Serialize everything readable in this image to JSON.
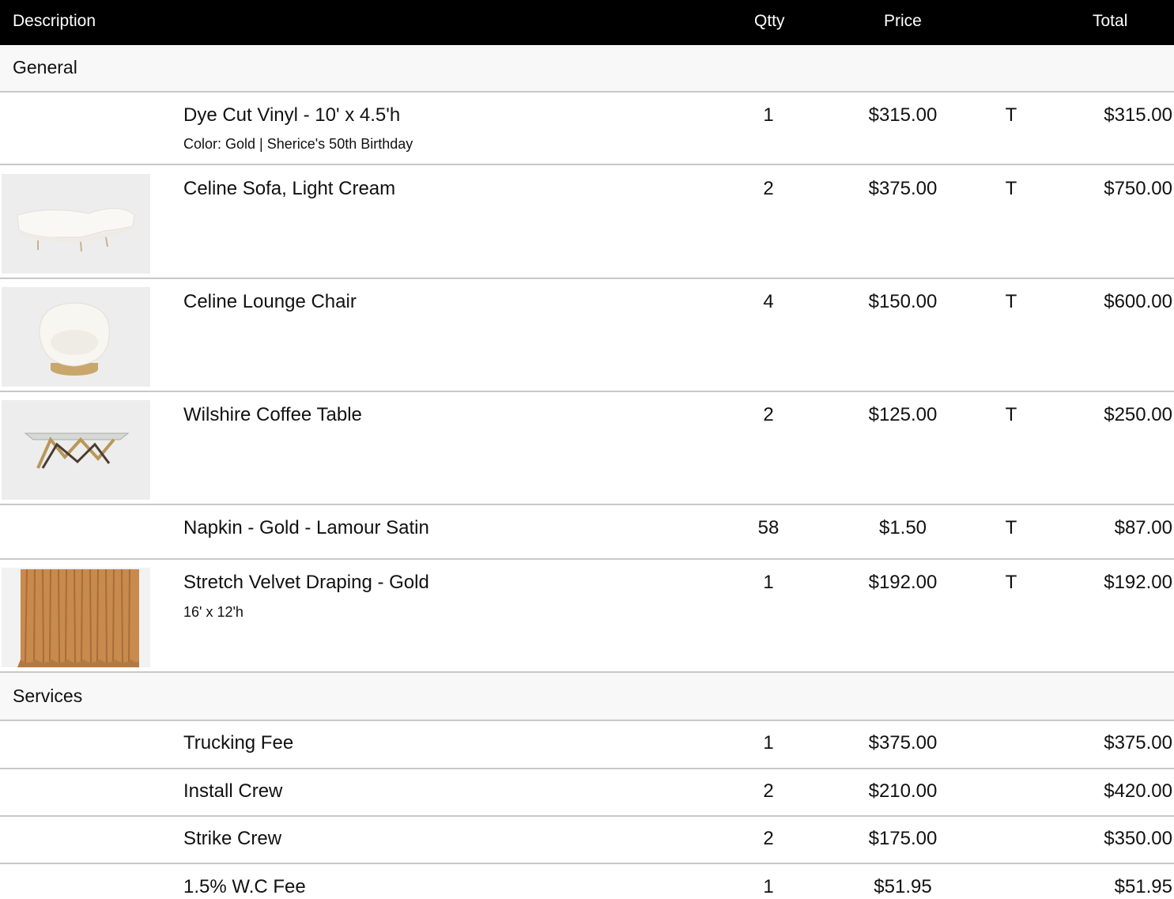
{
  "header": {
    "description": "Description",
    "qty": "Qtty",
    "price": "Price",
    "total": "Total"
  },
  "sections": [
    {
      "title": "General",
      "items": [
        {
          "name": "Dye Cut Vinyl - 10' x 4.5'h",
          "sub": "Color: Gold | Sherice's 50th Birthday",
          "qty": "1",
          "price": "$315.00",
          "tax": "T",
          "total": "$315.00",
          "image": ""
        },
        {
          "name": "Celine Sofa, Light Cream",
          "sub": "",
          "qty": "2",
          "price": "$375.00",
          "tax": "T",
          "total": "$750.00",
          "image": "sofa"
        },
        {
          "name": "Celine Lounge Chair",
          "sub": "",
          "qty": "4",
          "price": "$150.00",
          "tax": "T",
          "total": "$600.00",
          "image": "lounge-chair"
        },
        {
          "name": "Wilshire Coffee Table",
          "sub": "",
          "qty": "2",
          "price": "$125.00",
          "tax": "T",
          "total": "$250.00",
          "image": "coffee-table"
        },
        {
          "name": "Napkin - Gold - Lamour Satin",
          "sub": "",
          "qty": "58",
          "price": "$1.50",
          "tax": "T",
          "total": "$87.00",
          "image": ""
        },
        {
          "name": "Stretch Velvet Draping - Gold",
          "sub": "16' x 12'h",
          "qty": "1",
          "price": "$192.00",
          "tax": "T",
          "total": "$192.00",
          "image": "draping"
        }
      ]
    },
    {
      "title": "Services",
      "items": [
        {
          "name": "Trucking Fee",
          "sub": "",
          "qty": "1",
          "price": "$375.00",
          "tax": "",
          "total": "$375.00",
          "image": ""
        },
        {
          "name": "Install Crew",
          "sub": "",
          "qty": "2",
          "price": "$210.00",
          "tax": "",
          "total": "$420.00",
          "image": ""
        },
        {
          "name": "Strike Crew",
          "sub": "",
          "qty": "2",
          "price": "$175.00",
          "tax": "",
          "total": "$350.00",
          "image": ""
        },
        {
          "name": "1.5% W.C Fee",
          "sub": "",
          "qty": "1",
          "price": "$51.95",
          "tax": "",
          "total": "$51.95",
          "image": ""
        }
      ]
    }
  ]
}
